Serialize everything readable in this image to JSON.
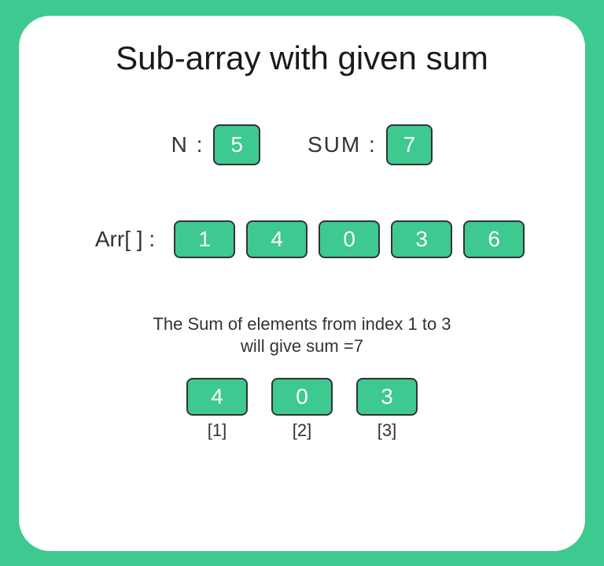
{
  "title": "Sub-array with given sum",
  "inputs": {
    "n_label": "N :",
    "n_value": "5",
    "sum_label": "SUM :",
    "sum_value": "7"
  },
  "array": {
    "label": "Arr[ ] :",
    "values": [
      "1",
      "4",
      "0",
      "3",
      "6"
    ]
  },
  "explanation": {
    "line1": "The Sum of elements from index 1 to 3",
    "line2": "will give sum =7"
  },
  "subarray": {
    "items": [
      {
        "value": "4",
        "index": "[1]"
      },
      {
        "value": "0",
        "index": "[2]"
      },
      {
        "value": "3",
        "index": "[3]"
      }
    ]
  }
}
